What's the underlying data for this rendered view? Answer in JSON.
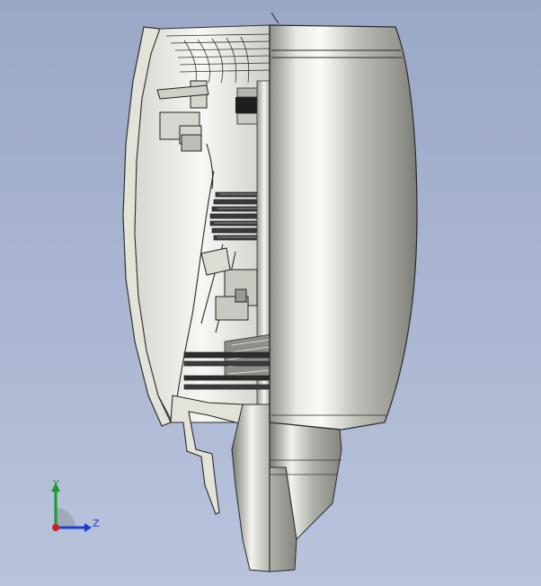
{
  "viewport": {
    "background_top": "#9aa8c6",
    "background_bottom": "#b9c3dc"
  },
  "model": {
    "name": "jet-engine-section",
    "body_color": "#c8c8c2",
    "section_color": "#e6e6dc"
  },
  "triad": {
    "y_label": "Y",
    "z_label": "Z",
    "y_color": "#1a9a2a",
    "z_color": "#1a3fd0",
    "x_color": "#d02020"
  }
}
